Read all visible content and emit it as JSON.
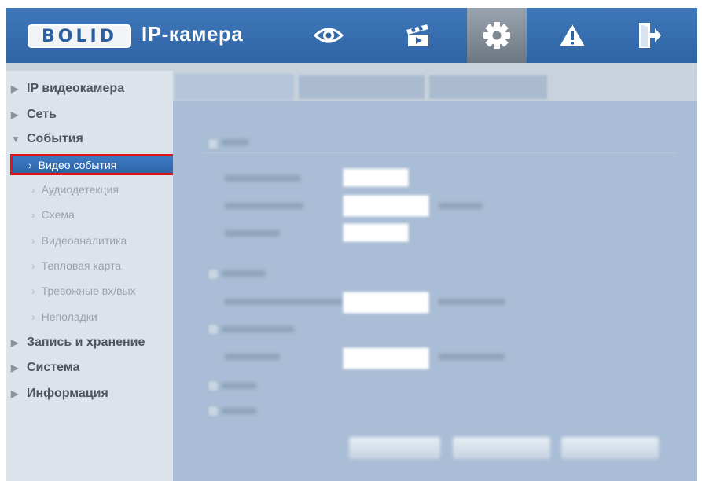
{
  "header": {
    "logo": "BOLID",
    "title": "IP-камера",
    "nav": [
      {
        "icon": "eye-icon",
        "active": false
      },
      {
        "icon": "clapperboard-icon",
        "active": false
      },
      {
        "icon": "gear-icon",
        "active": true
      },
      {
        "icon": "warning-icon",
        "active": false
      },
      {
        "icon": "logout-icon",
        "active": false
      }
    ]
  },
  "sidebar": {
    "items": [
      {
        "label": "IP видеокамера",
        "type": "section",
        "expanded": false
      },
      {
        "label": "Сеть",
        "type": "section",
        "expanded": false
      },
      {
        "label": "События",
        "type": "section",
        "expanded": true
      },
      {
        "label": "Видео события",
        "type": "sub",
        "selected": true
      },
      {
        "label": "Аудиодетекция",
        "type": "sub"
      },
      {
        "label": "Схема",
        "type": "sub"
      },
      {
        "label": "Видеоаналитика",
        "type": "sub"
      },
      {
        "label": "Тепловая карта",
        "type": "sub"
      },
      {
        "label": "Тревожные вх/вых",
        "type": "sub"
      },
      {
        "label": "Неполадки",
        "type": "sub"
      },
      {
        "label": "Запись и хранение",
        "type": "section",
        "expanded": false
      },
      {
        "label": "Система",
        "type": "section",
        "expanded": false
      },
      {
        "label": "Информация",
        "type": "section",
        "expanded": false
      }
    ]
  },
  "colors": {
    "header": "#3a71b3",
    "selected": "#2f68ae",
    "highlight_border": "#e0121a",
    "sidebar_bg": "#dde3ea",
    "main_bg": "#a9bdd6"
  }
}
